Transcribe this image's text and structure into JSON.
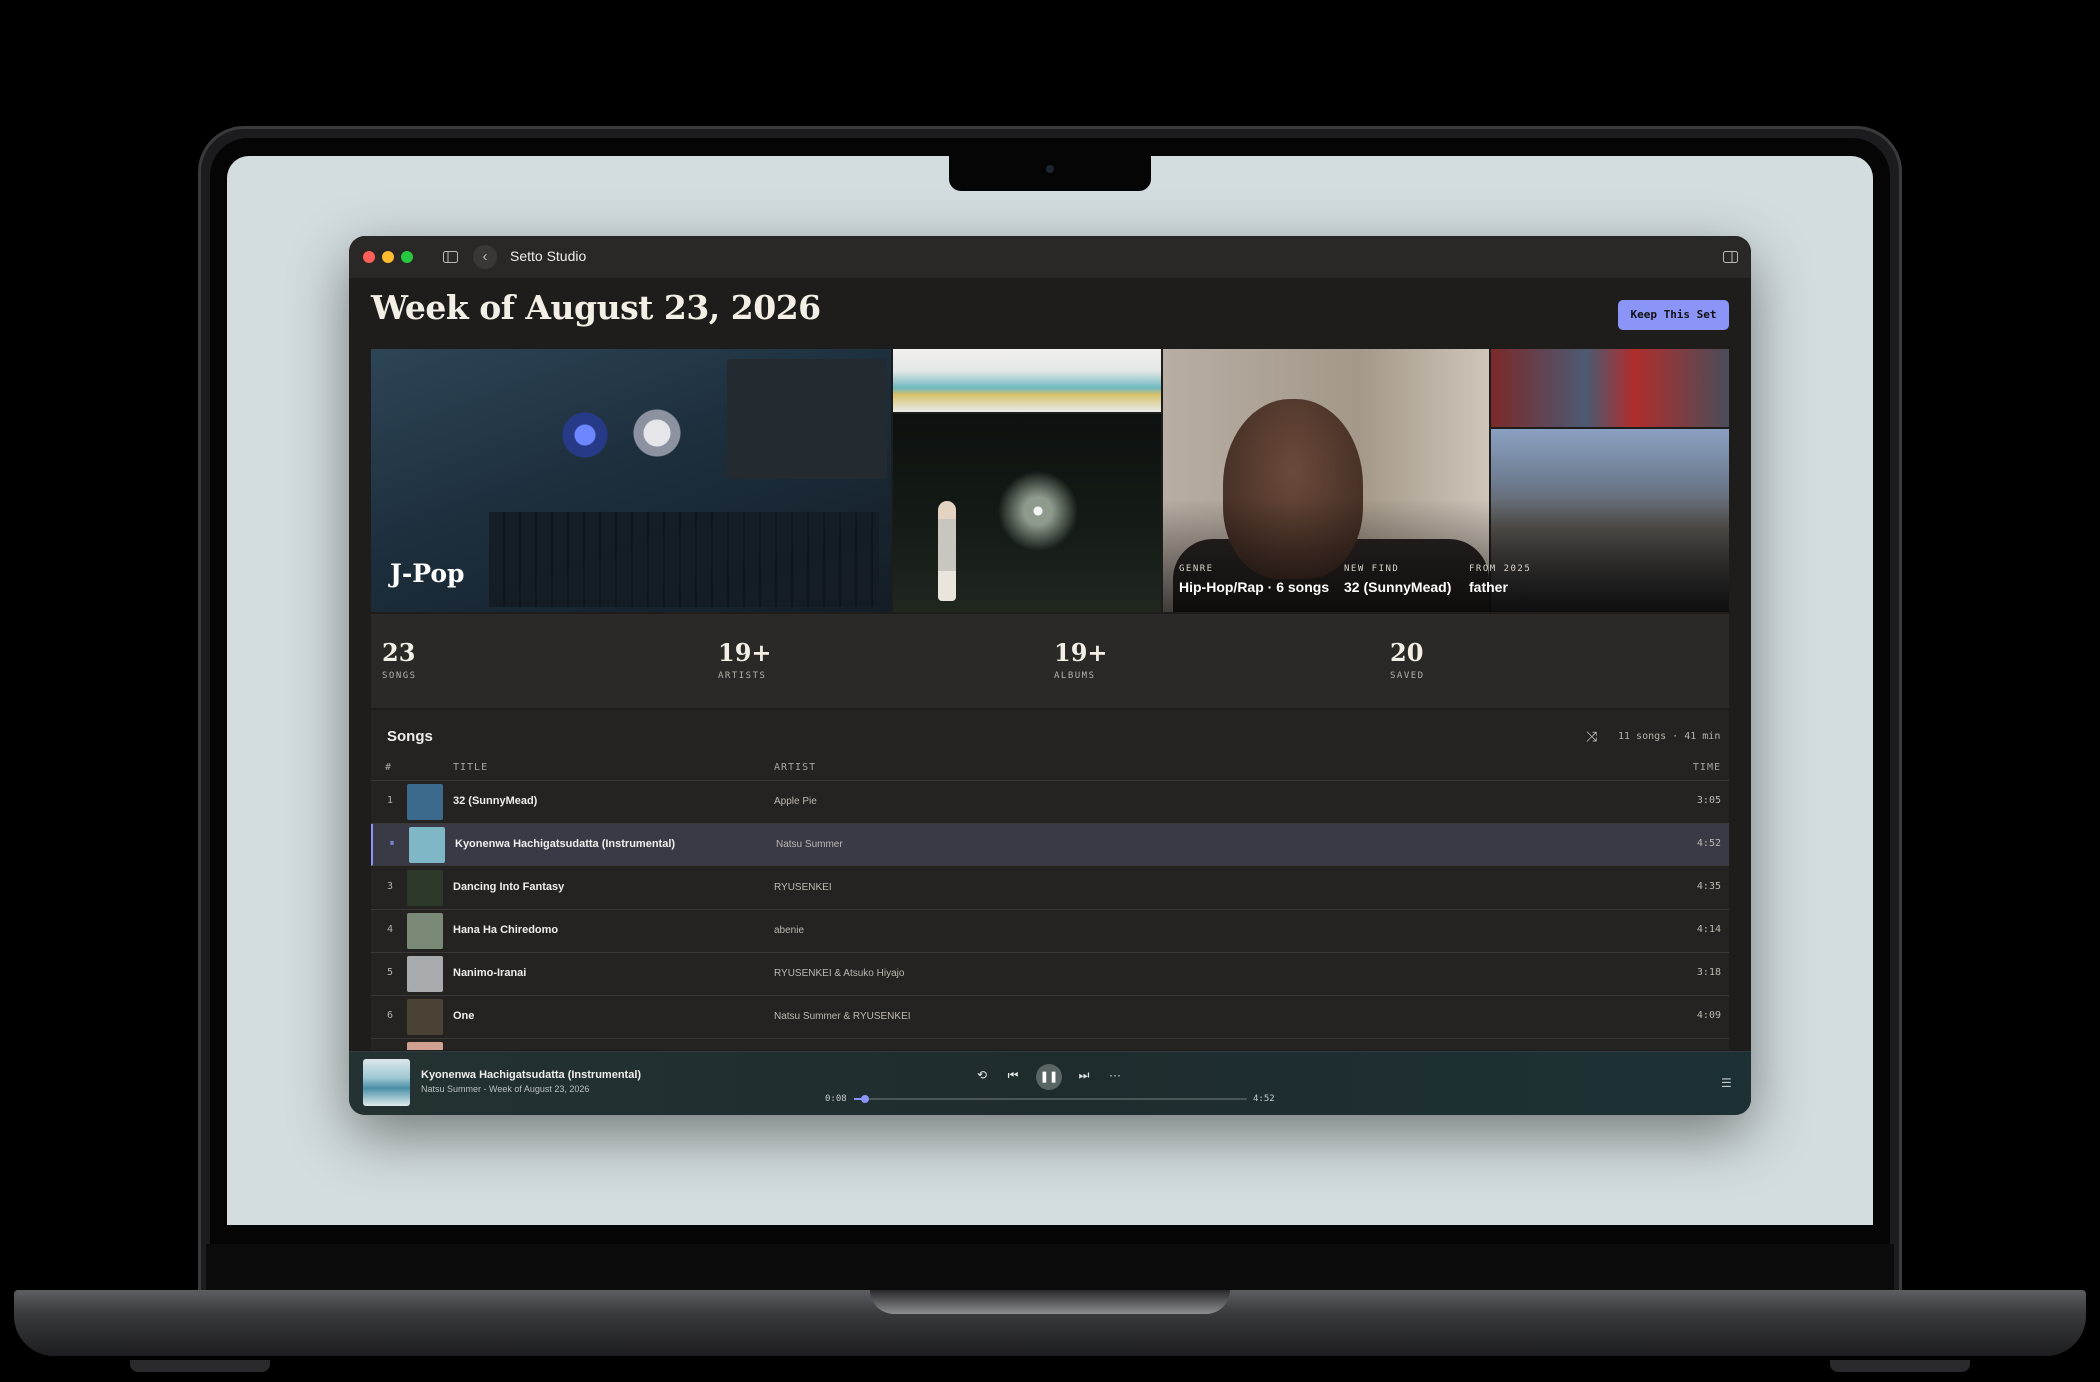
{
  "window": {
    "title": "Setto Studio"
  },
  "icons": {
    "sidebar_toggle": "sidebar-toggle-icon",
    "back": "chevron-left-icon",
    "inspector": "inspector-panel-icon",
    "shuffle": "shuffle-icon",
    "repeat": "repeat-icon",
    "prev": "rewind-icon",
    "next": "fast-forward-icon",
    "more": "ellipsis-icon",
    "queue": "queue-list-icon"
  },
  "page": {
    "title": "Week of August 23, 2026",
    "keep_button": "Keep This Set"
  },
  "hero": {
    "label": "J-Pop",
    "meta": [
      {
        "key": "GENRE",
        "value": "Hip-Hop/Rap · 6 songs"
      },
      {
        "key": "NEW FIND",
        "value": "32 (SunnyMead)"
      },
      {
        "key": "FROM 2025",
        "value": "father"
      }
    ]
  },
  "stats": [
    {
      "value": "23",
      "label": "SONGS"
    },
    {
      "value": "19+",
      "label": "ARTISTS"
    },
    {
      "value": "19+",
      "label": "ALBUMS"
    },
    {
      "value": "20",
      "label": "SAVED"
    }
  ],
  "songs": {
    "title": "Songs",
    "summary": "11 songs · 41 min",
    "columns": {
      "num": "#",
      "title": "TITLE",
      "artist": "ARTIST",
      "time": "TIME"
    },
    "rows": [
      {
        "num": "1",
        "title": "32 (SunnyMead)",
        "artist": "Apple Pie",
        "time": "3:05",
        "art": "#3c6a8c"
      },
      {
        "num": "⏸",
        "title": "Kyonenwa Hachigatsudatta (Instrumental)",
        "artist": "Natsu Summer",
        "time": "4:52",
        "art": "#7fb7c6",
        "active": true
      },
      {
        "num": "3",
        "title": "Dancing Into Fantasy",
        "artist": "RYUSENKEI",
        "time": "4:35",
        "art": "#2d3a2a"
      },
      {
        "num": "4",
        "title": "Hana Ha Chiredomo",
        "artist": "abenie",
        "time": "4:14",
        "art": "#7b8a76"
      },
      {
        "num": "5",
        "title": "Nanimo-Iranai",
        "artist": "RYUSENKEI & Atsuko Hiyajo",
        "time": "3:18",
        "art": "#a7abad"
      },
      {
        "num": "6",
        "title": "One",
        "artist": "Natsu Summer & RYUSENKEI",
        "time": "4:09",
        "art": "#4a4234"
      },
      {
        "num": "",
        "title": "",
        "artist": "",
        "time": "",
        "art": "#d0a090"
      }
    ]
  },
  "player": {
    "title": "Kyonenwa Hachigatsudatta (Instrumental)",
    "subtitle": "Natsu Summer - Week of August 23, 2026",
    "elapsed": "0:08",
    "duration": "4:52",
    "progress": 0.027
  },
  "colors": {
    "accent": "#8a95f7",
    "window_bg": "#1f1d1c",
    "screen_bg": "#d3dde0"
  }
}
